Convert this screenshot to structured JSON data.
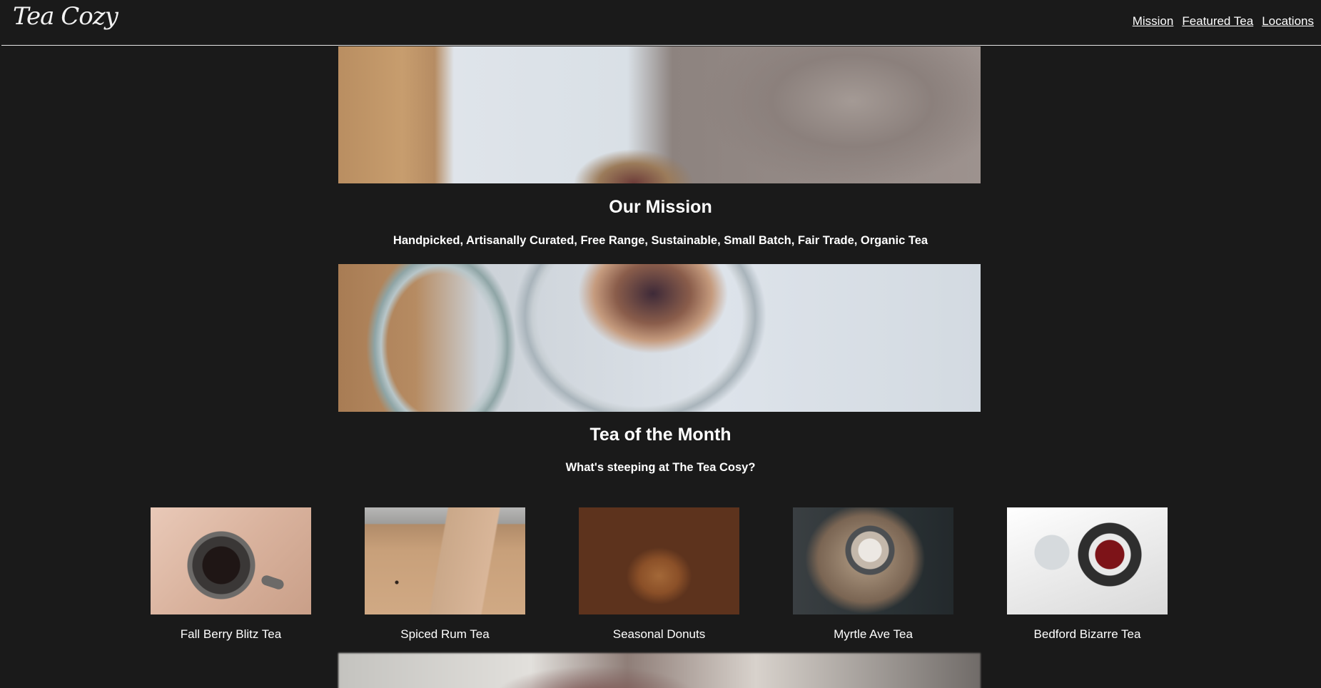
{
  "header": {
    "logo_text": "Tea Cozy",
    "nav": [
      {
        "label": "Mission"
      },
      {
        "label": "Featured Tea"
      },
      {
        "label": "Locations"
      }
    ]
  },
  "mission": {
    "title": "Our Mission",
    "subtitle": "Handpicked, Artisanally Curated, Free Range, Sustainable, Small Batch, Fair Trade, Organic Tea"
  },
  "featured": {
    "title": "Tea of the Month",
    "subtitle": "What's steeping at The Tea Cosy?",
    "items": [
      {
        "label": "Fall Berry Blitz Tea"
      },
      {
        "label": "Spiced Rum Tea"
      },
      {
        "label": "Seasonal Donuts"
      },
      {
        "label": "Myrtle Ave Tea"
      },
      {
        "label": "Bedford Bizarre Tea"
      }
    ]
  },
  "theme": {
    "background": "#1a1a1a",
    "text": "#ffffff"
  }
}
